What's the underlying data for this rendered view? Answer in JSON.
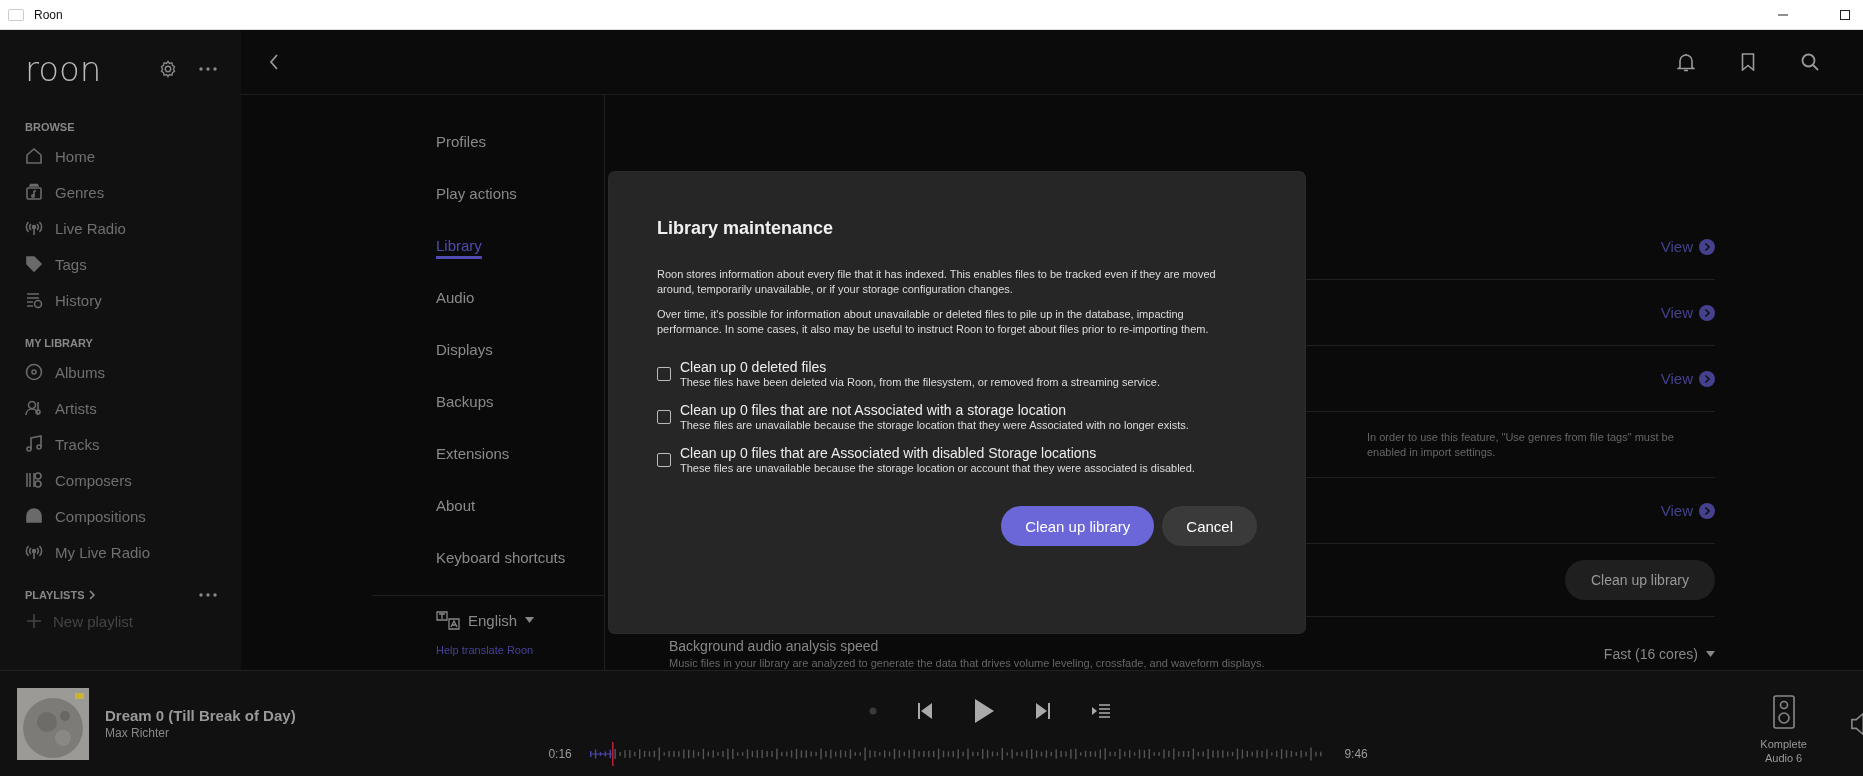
{
  "window": {
    "title": "Roon"
  },
  "sidebar": {
    "logo": "roon",
    "sections": [
      {
        "heading": "BROWSE",
        "items": [
          {
            "label": "Home"
          },
          {
            "label": "Genres"
          },
          {
            "label": "Live Radio"
          },
          {
            "label": "Tags"
          },
          {
            "label": "History"
          }
        ]
      },
      {
        "heading": "MY LIBRARY",
        "items": [
          {
            "label": "Albums"
          },
          {
            "label": "Artists"
          },
          {
            "label": "Tracks"
          },
          {
            "label": "Composers"
          },
          {
            "label": "Compositions"
          },
          {
            "label": "My Live Radio"
          }
        ]
      }
    ],
    "playlists": {
      "heading": "PLAYLISTS",
      "new_playlist": "New playlist"
    }
  },
  "settings_nav": {
    "items": [
      {
        "label": "Profiles",
        "selected": false
      },
      {
        "label": "Play actions",
        "selected": false
      },
      {
        "label": "Library",
        "selected": true
      },
      {
        "label": "Audio",
        "selected": false
      },
      {
        "label": "Displays",
        "selected": false
      },
      {
        "label": "Backups",
        "selected": false
      },
      {
        "label": "Extensions",
        "selected": false
      },
      {
        "label": "About",
        "selected": false
      },
      {
        "label": "Keyboard shortcuts",
        "selected": false
      }
    ],
    "language": "English",
    "help_link": "Help translate Roon"
  },
  "content": {
    "rows": [
      {
        "kind": "link",
        "action": "View"
      },
      {
        "kind": "link",
        "action": "View"
      },
      {
        "kind": "link",
        "action": "View"
      },
      {
        "kind": "note",
        "note": "In order to use this feature, \"Use genres from file tags\" must be enabled in import settings."
      },
      {
        "kind": "link",
        "action": "View"
      },
      {
        "kind": "button",
        "action": "Clean up library"
      },
      {
        "kind": "select",
        "title": "Background audio analysis speed",
        "description": "Music files in your library are analyzed to generate the data that drives volume leveling, crossfade, and waveform displays.",
        "value": "Fast (16 cores)"
      }
    ]
  },
  "dialog": {
    "title": "Library maintenance",
    "paragraphs": [
      "Roon stores information about every file that it has indexed. This enables files to be tracked even if they are moved around, temporarily unavailable, or if your storage configuration changes.",
      "Over time, it's possible for information about unavailable or deleted files to pile up in the database, impacting performance. In some cases, it also may be useful to instruct Roon to forget about files prior to re-importing them."
    ],
    "options": [
      {
        "label": "Clean up 0 deleted files",
        "description": "These files have been deleted via Roon, from the filesystem, or removed from a streaming service.",
        "checked": false
      },
      {
        "label": "Clean up 0 files that are not Associated with a storage location",
        "description": "These files are unavailable because the storage location that they were Associated with no longer exists.",
        "checked": false
      },
      {
        "label": "Clean up 0 files that are Associated with disabled Storage locations",
        "description": "These files are unavailable because the storage location or account that they were associated is disabled.",
        "checked": false
      }
    ],
    "primary_button": "Clean up library",
    "cancel_button": "Cancel"
  },
  "player": {
    "title": "Dream 0 (Till Break of Day)",
    "artist": "Max Richter",
    "elapsed": "0:16",
    "duration": "9:46",
    "progress": {
      "level": 0.03
    },
    "output": "Komplete Audio 6"
  }
}
